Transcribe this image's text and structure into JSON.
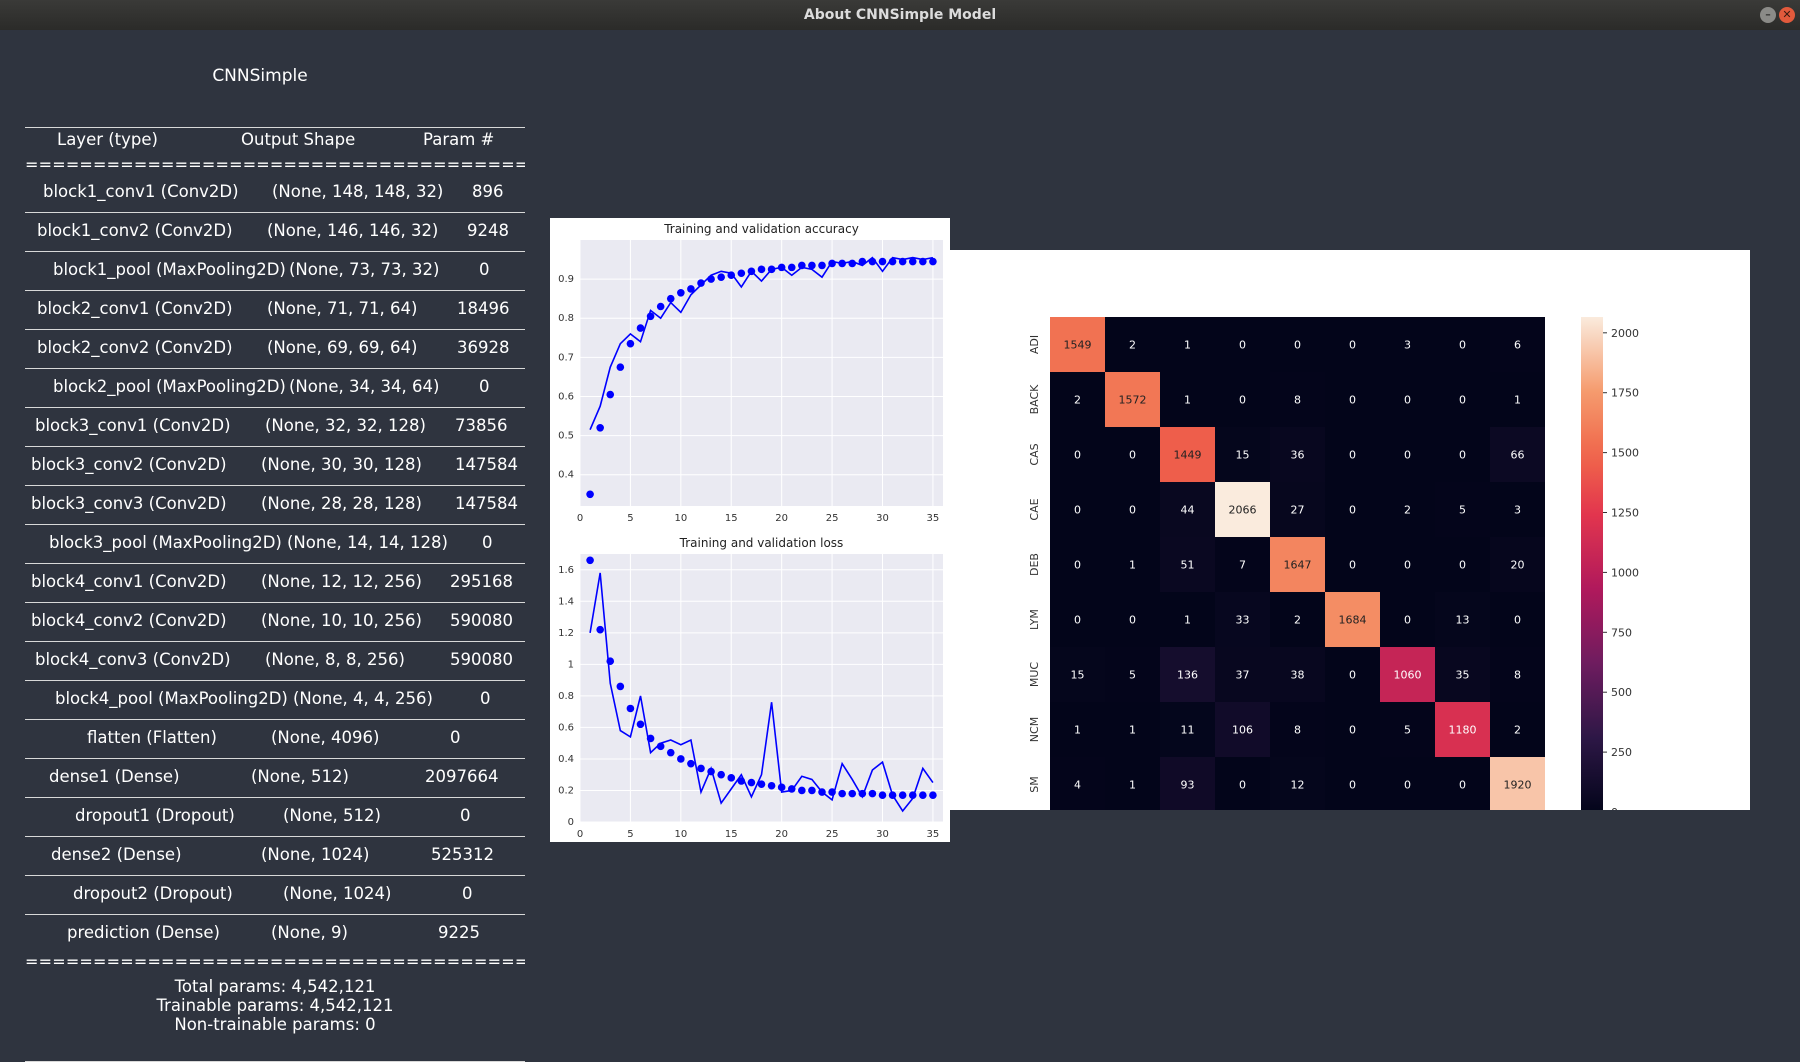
{
  "window": {
    "title": "About CNNSimple Model",
    "min_glyph": "–",
    "close_glyph": "✕"
  },
  "model": {
    "name": "CNNSimple",
    "headers": {
      "layer": "Layer (type)",
      "shape": "Output Shape",
      "params": "Param #"
    },
    "separator": "==================================================",
    "layers": [
      {
        "layer": "block1_conv1 (Conv2D)",
        "shape": "(None, 148, 148, 32)",
        "params": "896"
      },
      {
        "layer": "block1_conv2 (Conv2D)",
        "shape": "(None, 146, 146, 32)",
        "params": "9248"
      },
      {
        "layer": "block1_pool (MaxPooling2D)",
        "shape": "(None, 73, 73, 32)",
        "params": "0"
      },
      {
        "layer": "block2_conv1 (Conv2D)",
        "shape": "(None, 71, 71, 64)",
        "params": "18496"
      },
      {
        "layer": "block2_conv2 (Conv2D)",
        "shape": "(None, 69, 69, 64)",
        "params": "36928"
      },
      {
        "layer": "block2_pool (MaxPooling2D)",
        "shape": "(None, 34, 34, 64)",
        "params": "0"
      },
      {
        "layer": "block3_conv1 (Conv2D)",
        "shape": "(None, 32, 32, 128)",
        "params": "73856"
      },
      {
        "layer": "block3_conv2 (Conv2D)",
        "shape": "(None, 30, 30, 128)",
        "params": "147584"
      },
      {
        "layer": "block3_conv3 (Conv2D)",
        "shape": "(None, 28, 28, 128)",
        "params": "147584"
      },
      {
        "layer": "block3_pool (MaxPooling2D)",
        "shape": "(None, 14, 14, 128)",
        "params": "0"
      },
      {
        "layer": "block4_conv1 (Conv2D)",
        "shape": "(None, 12, 12, 256)",
        "params": "295168"
      },
      {
        "layer": "block4_conv2 (Conv2D)",
        "shape": "(None, 10, 10, 256)",
        "params": "590080"
      },
      {
        "layer": "block4_conv3 (Conv2D)",
        "shape": "(None, 8, 8, 256)",
        "params": "590080"
      },
      {
        "layer": "block4_pool (MaxPooling2D)",
        "shape": "(None, 4, 4, 256)",
        "params": "0"
      },
      {
        "layer": "flatten (Flatten)",
        "shape": "(None, 4096)",
        "params": "0"
      },
      {
        "layer": "dense1 (Dense)",
        "shape": "(None, 512)",
        "params": "2097664"
      },
      {
        "layer": "dropout1 (Dropout)",
        "shape": "(None, 512)",
        "params": "0"
      },
      {
        "layer": "dense2 (Dense)",
        "shape": "(None, 1024)",
        "params": "525312"
      },
      {
        "layer": "dropout2 (Dropout)",
        "shape": "(None, 1024)",
        "params": "0"
      },
      {
        "layer": "prediction (Dense)",
        "shape": "(None, 9)",
        "params": "9225"
      }
    ],
    "total_params": "Total params: 4,542,121",
    "trainable_params": "Trainable params: 4,542,121",
    "non_trainable_params": "Non-trainable params: 0"
  },
  "chart_data": [
    {
      "type": "line",
      "title": "Training and validation accuracy",
      "xlabel": "",
      "ylabel": "",
      "xlim": [
        0,
        36
      ],
      "ylim": [
        0.32,
        1.0
      ],
      "xticks": [
        0,
        5,
        10,
        15,
        20,
        25,
        30,
        35
      ],
      "yticks": [
        0.4,
        0.5,
        0.6,
        0.7,
        0.8,
        0.9
      ],
      "grid": true,
      "colors": {
        "series": "#0000ff",
        "background": "#eaeaf2"
      },
      "series": [
        {
          "style": "dots",
          "x": [
            1,
            2,
            3,
            4,
            5,
            6,
            7,
            8,
            9,
            10,
            11,
            12,
            13,
            14,
            15,
            16,
            17,
            18,
            19,
            20,
            21,
            22,
            23,
            24,
            25,
            26,
            27,
            28,
            29,
            30,
            31,
            32,
            33,
            34,
            35
          ],
          "values": [
            0.35,
            0.52,
            0.605,
            0.675,
            0.735,
            0.775,
            0.805,
            0.83,
            0.85,
            0.865,
            0.875,
            0.89,
            0.9,
            0.905,
            0.91,
            0.915,
            0.92,
            0.925,
            0.925,
            0.93,
            0.93,
            0.935,
            0.935,
            0.935,
            0.94,
            0.94,
            0.94,
            0.945,
            0.945,
            0.945,
            0.945,
            0.945,
            0.945,
            0.945,
            0.945
          ]
        },
        {
          "style": "line",
          "x": [
            1,
            2,
            3,
            4,
            5,
            6,
            7,
            8,
            9,
            10,
            11,
            12,
            13,
            14,
            15,
            16,
            17,
            18,
            19,
            20,
            21,
            22,
            23,
            24,
            25,
            26,
            27,
            28,
            29,
            30,
            31,
            32,
            33,
            34,
            35
          ],
          "values": [
            0.515,
            0.575,
            0.675,
            0.735,
            0.76,
            0.74,
            0.82,
            0.8,
            0.84,
            0.815,
            0.86,
            0.885,
            0.91,
            0.92,
            0.915,
            0.88,
            0.92,
            0.895,
            0.925,
            0.93,
            0.91,
            0.93,
            0.925,
            0.905,
            0.945,
            0.94,
            0.945,
            0.935,
            0.955,
            0.92,
            0.955,
            0.95,
            0.955,
            0.95,
            0.955
          ]
        }
      ]
    },
    {
      "type": "line",
      "title": "Training and validation loss",
      "xlabel": "",
      "ylabel": "",
      "xlim": [
        0,
        36
      ],
      "ylim": [
        0,
        1.7
      ],
      "xticks": [
        0,
        5,
        10,
        15,
        20,
        25,
        30,
        35
      ],
      "yticks": [
        0.0,
        0.2,
        0.4,
        0.6,
        0.8,
        1.0,
        1.2,
        1.4,
        1.6
      ],
      "grid": true,
      "colors": {
        "series": "#0000ff",
        "background": "#eaeaf2"
      },
      "series": [
        {
          "style": "dots",
          "x": [
            1,
            2,
            3,
            4,
            5,
            6,
            7,
            8,
            9,
            10,
            11,
            12,
            13,
            14,
            15,
            16,
            17,
            18,
            19,
            20,
            21,
            22,
            23,
            24,
            25,
            26,
            27,
            28,
            29,
            30,
            31,
            32,
            33,
            34,
            35
          ],
          "values": [
            1.66,
            1.22,
            1.02,
            0.86,
            0.72,
            0.62,
            0.53,
            0.48,
            0.44,
            0.4,
            0.37,
            0.34,
            0.32,
            0.3,
            0.28,
            0.26,
            0.25,
            0.24,
            0.23,
            0.22,
            0.21,
            0.2,
            0.2,
            0.19,
            0.19,
            0.18,
            0.18,
            0.18,
            0.18,
            0.17,
            0.17,
            0.17,
            0.17,
            0.17,
            0.17
          ]
        },
        {
          "style": "line",
          "x": [
            1,
            2,
            3,
            4,
            5,
            6,
            7,
            8,
            9,
            10,
            11,
            12,
            13,
            14,
            15,
            16,
            17,
            18,
            19,
            20,
            21,
            22,
            23,
            24,
            25,
            26,
            27,
            28,
            29,
            30,
            31,
            32,
            33,
            34,
            35
          ],
          "values": [
            1.2,
            1.58,
            0.88,
            0.58,
            0.54,
            0.8,
            0.44,
            0.5,
            0.52,
            0.49,
            0.52,
            0.19,
            0.34,
            0.12,
            0.21,
            0.3,
            0.16,
            0.3,
            0.76,
            0.19,
            0.2,
            0.29,
            0.27,
            0.19,
            0.14,
            0.37,
            0.27,
            0.16,
            0.33,
            0.38,
            0.17,
            0.07,
            0.15,
            0.34,
            0.25
          ]
        }
      ]
    },
    {
      "type": "heatmap",
      "title": "",
      "xlabel": "",
      "ylabel": "",
      "categories": [
        "ADI",
        "BACK",
        "CAS",
        "CAE",
        "DEB",
        "LYM",
        "MUC",
        "NCM",
        "SM"
      ],
      "values": [
        [
          1549,
          2,
          1,
          0,
          0,
          0,
          3,
          0,
          6
        ],
        [
          2,
          1572,
          1,
          0,
          8,
          0,
          0,
          0,
          1
        ],
        [
          0,
          0,
          1449,
          15,
          36,
          0,
          0,
          0,
          66
        ],
        [
          0,
          0,
          44,
          2066,
          27,
          0,
          2,
          5,
          3
        ],
        [
          0,
          1,
          51,
          7,
          1647,
          0,
          0,
          0,
          20
        ],
        [
          0,
          0,
          1,
          33,
          2,
          1684,
          0,
          13,
          0
        ],
        [
          15,
          5,
          136,
          37,
          38,
          0,
          1060,
          35,
          8
        ],
        [
          1,
          1,
          11,
          106,
          8,
          0,
          5,
          1180,
          2
        ],
        [
          4,
          1,
          93,
          0,
          12,
          0,
          0,
          0,
          1920
        ]
      ],
      "colorbar": {
        "min": 0,
        "max": 2066,
        "ticks": [
          0,
          250,
          500,
          750,
          1000,
          1250,
          1500,
          1750,
          2000
        ]
      },
      "colormap": "rocket"
    }
  ]
}
